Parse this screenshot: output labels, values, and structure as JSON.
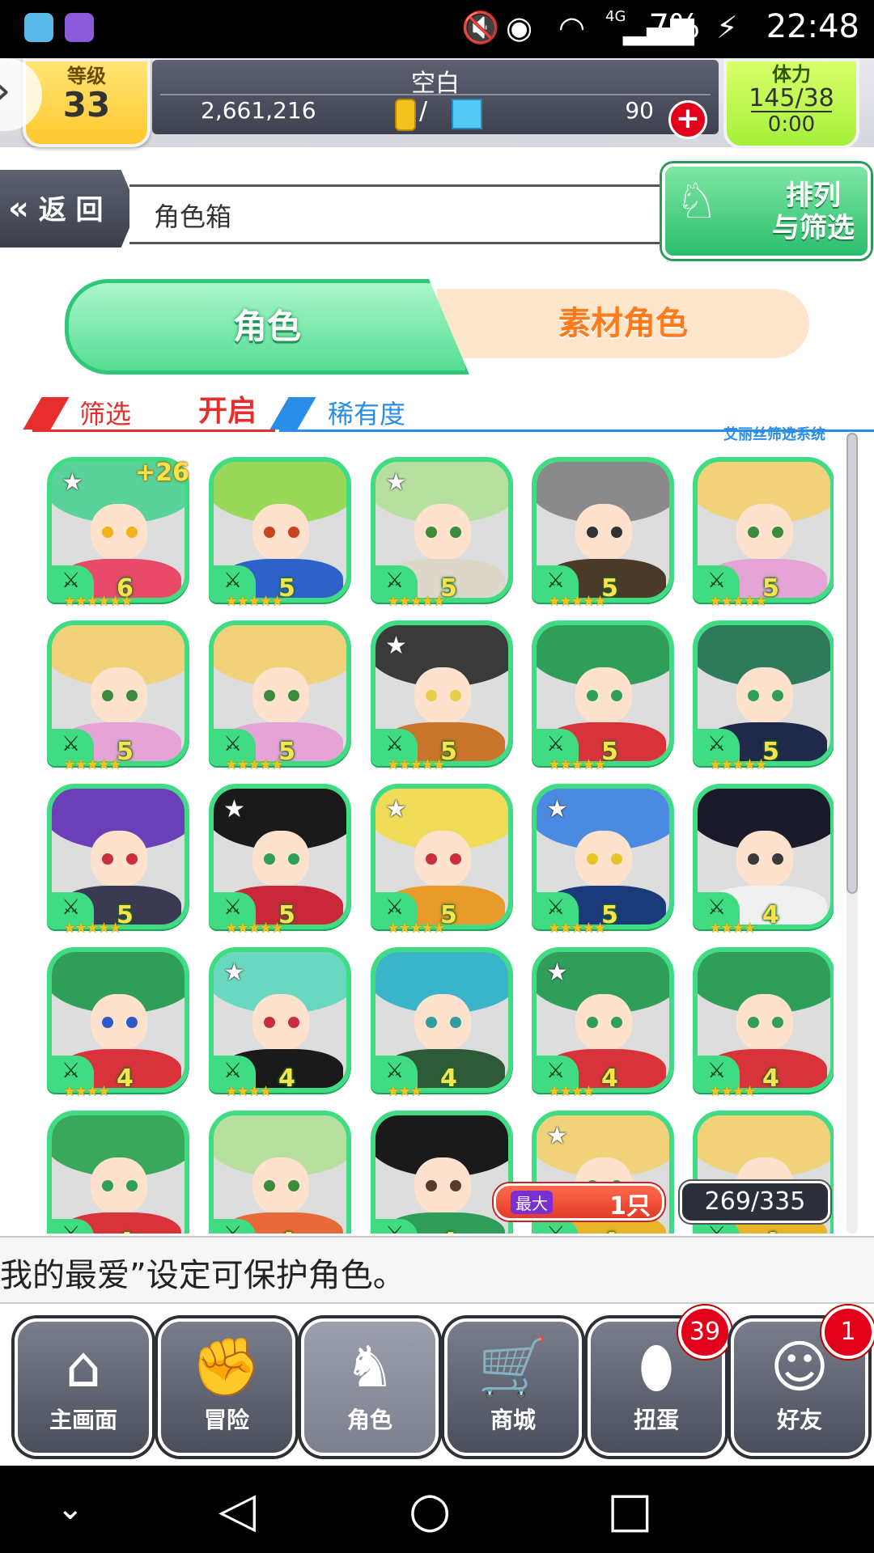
{
  "status_bar": {
    "time": "22:48",
    "battery": "7%",
    "network": "4G"
  },
  "header": {
    "level_label": "等级",
    "level": "33",
    "player_name": "空白",
    "gold": "2,661,216",
    "gems": "90",
    "stamina_label": "体力",
    "stamina": "145/38",
    "stamina_timer": "0:00"
  },
  "nav": {
    "back_label": "返 回",
    "title": "角色箱",
    "sort_label_line1": "排列",
    "sort_label_line2": "与筛选"
  },
  "tabs": [
    {
      "label": "角色",
      "active": true
    },
    {
      "label": "素材角色",
      "active": false
    }
  ],
  "filter": {
    "filter_label": "筛选",
    "filter_state": "开启",
    "rarity_label": "稀有度",
    "system_label": "艾丽丝筛选系统"
  },
  "characters": [
    {
      "level": "6",
      "stars": "★★★★★★",
      "favorite": true,
      "plus": "+26",
      "hair": "#59d29b",
      "cloth": "#e94a6a",
      "eye": "#f3b21d"
    },
    {
      "level": "5",
      "stars": "★★★★★",
      "favorite": false,
      "plus": "",
      "hair": "#9ad85a",
      "cloth": "#2e62c8",
      "eye": "#c8421d"
    },
    {
      "level": "5",
      "stars": "★★★★★",
      "favorite": true,
      "plus": "",
      "hair": "#b7e0a0",
      "cloth": "#dcd7c8",
      "eye": "#3b8b3b"
    },
    {
      "level": "5",
      "stars": "★★★★★",
      "favorite": false,
      "plus": "",
      "hair": "#8a8a8a",
      "cloth": "#4b3a2a",
      "eye": "#333333"
    },
    {
      "level": "5",
      "stars": "★★★★★",
      "favorite": false,
      "plus": "",
      "hair": "#f1d27a",
      "cloth": "#e6a3d5",
      "eye": "#3b8b3b"
    },
    {
      "level": "5",
      "stars": "★★★★★",
      "favorite": false,
      "plus": "",
      "hair": "#f1d27a",
      "cloth": "#e6a3d5",
      "eye": "#3b8b3b"
    },
    {
      "level": "5",
      "stars": "★★★★★",
      "favorite": false,
      "plus": "",
      "hair": "#f1d27a",
      "cloth": "#e6a3d5",
      "eye": "#3b8b3b"
    },
    {
      "level": "5",
      "stars": "★★★★★",
      "favorite": true,
      "plus": "",
      "hair": "#3a3a3a",
      "cloth": "#c8742a",
      "eye": "#e8d04a"
    },
    {
      "level": "5",
      "stars": "★★★★★",
      "favorite": false,
      "plus": "",
      "hair": "#2f9e5a",
      "cloth": "#d8333a",
      "eye": "#2f9e5a"
    },
    {
      "level": "5",
      "stars": "★★★★★",
      "favorite": false,
      "plus": "",
      "hair": "#2f7a5a",
      "cloth": "#1f2a4a",
      "eye": "#2f9e5a"
    },
    {
      "level": "5",
      "stars": "★★★★★",
      "favorite": false,
      "plus": "",
      "hair": "#6a3fb8",
      "cloth": "#3a3a52",
      "eye": "#c82f3a"
    },
    {
      "level": "5",
      "stars": "★★★★★",
      "favorite": true,
      "plus": "",
      "hair": "#1a1a1a",
      "cloth": "#c8283a",
      "eye": "#2f9e5a"
    },
    {
      "level": "5",
      "stars": "★★★★★",
      "favorite": true,
      "plus": "",
      "hair": "#f1dc5a",
      "cloth": "#e89a2a",
      "eye": "#c82f3a"
    },
    {
      "level": "5",
      "stars": "★★★★★",
      "favorite": true,
      "plus": "",
      "hair": "#4a8ae0",
      "cloth": "#1a3a7a",
      "eye": "#e8c42a"
    },
    {
      "level": "4",
      "stars": "★★★★",
      "favorite": false,
      "plus": "",
      "hair": "#1a1a2a",
      "cloth": "#f0f0f0",
      "eye": "#3a3a3a"
    },
    {
      "level": "4",
      "stars": "★★★★",
      "favorite": false,
      "plus": "",
      "hair": "#2f9e5a",
      "cloth": "#d8333a",
      "eye": "#2a5ac8"
    },
    {
      "level": "4",
      "stars": "★★★★",
      "favorite": true,
      "plus": "",
      "hair": "#6ad8c0",
      "cloth": "#1a1a1a",
      "eye": "#c82f3a"
    },
    {
      "level": "4",
      "stars": "★★★",
      "favorite": false,
      "plus": "",
      "hair": "#3ab4c8",
      "cloth": "#2f5a3a",
      "eye": "#2f9e9e"
    },
    {
      "level": "4",
      "stars": "★★★★",
      "favorite": true,
      "plus": "",
      "hair": "#2f9e5a",
      "cloth": "#d8333a",
      "eye": "#2f9e5a"
    },
    {
      "level": "4",
      "stars": "★★★★",
      "favorite": false,
      "plus": "",
      "hair": "#2f9e5a",
      "cloth": "#d8333a",
      "eye": "#2f9e5a"
    },
    {
      "level": "4",
      "stars": "★★★★",
      "favorite": false,
      "plus": "",
      "hair": "#3aa85a",
      "cloth": "#d8333a",
      "eye": "#2f9e5a"
    },
    {
      "level": "4",
      "stars": "★★★★",
      "favorite": false,
      "plus": "",
      "hair": "#b7e0a0",
      "cloth": "#e86a3a",
      "eye": "#3b8b3b"
    },
    {
      "level": "4",
      "stars": "★★★★",
      "favorite": false,
      "plus": "",
      "hair": "#1a1a1a",
      "cloth": "#2f9e5a",
      "eye": "#5a3a2a"
    },
    {
      "level": "4",
      "stars": "★★★★",
      "favorite": true,
      "plus": "",
      "hair": "#f1d27a",
      "cloth": "#e8b42a",
      "eye": "#2f9e5a"
    },
    {
      "level": "4",
      "stars": "★★★★",
      "favorite": false,
      "plus": "",
      "hair": "#f1d27a",
      "cloth": "#e8b42a",
      "eye": "#2f9e5a"
    }
  ],
  "counters": {
    "max_tag": "最大",
    "max_count": "1只",
    "box_count": "269/335"
  },
  "ticker": "我的最爱”设定可保护角色。",
  "bottom_nav": [
    {
      "label": "主画面",
      "icon": "home-icon",
      "glyph": "⌂",
      "badge": ""
    },
    {
      "label": "冒险",
      "icon": "handshake-icon",
      "glyph": "✊",
      "badge": ""
    },
    {
      "label": "角色",
      "icon": "rabbit-icon",
      "glyph": "♞",
      "badge": "",
      "active": true
    },
    {
      "label": "商城",
      "icon": "cart-icon",
      "glyph": "🛒",
      "badge": ""
    },
    {
      "label": "扭蛋",
      "icon": "egg-icon",
      "glyph": "⬮",
      "badge": "39"
    },
    {
      "label": "好友",
      "icon": "friends-icon",
      "glyph": "☺",
      "badge": "1"
    }
  ]
}
